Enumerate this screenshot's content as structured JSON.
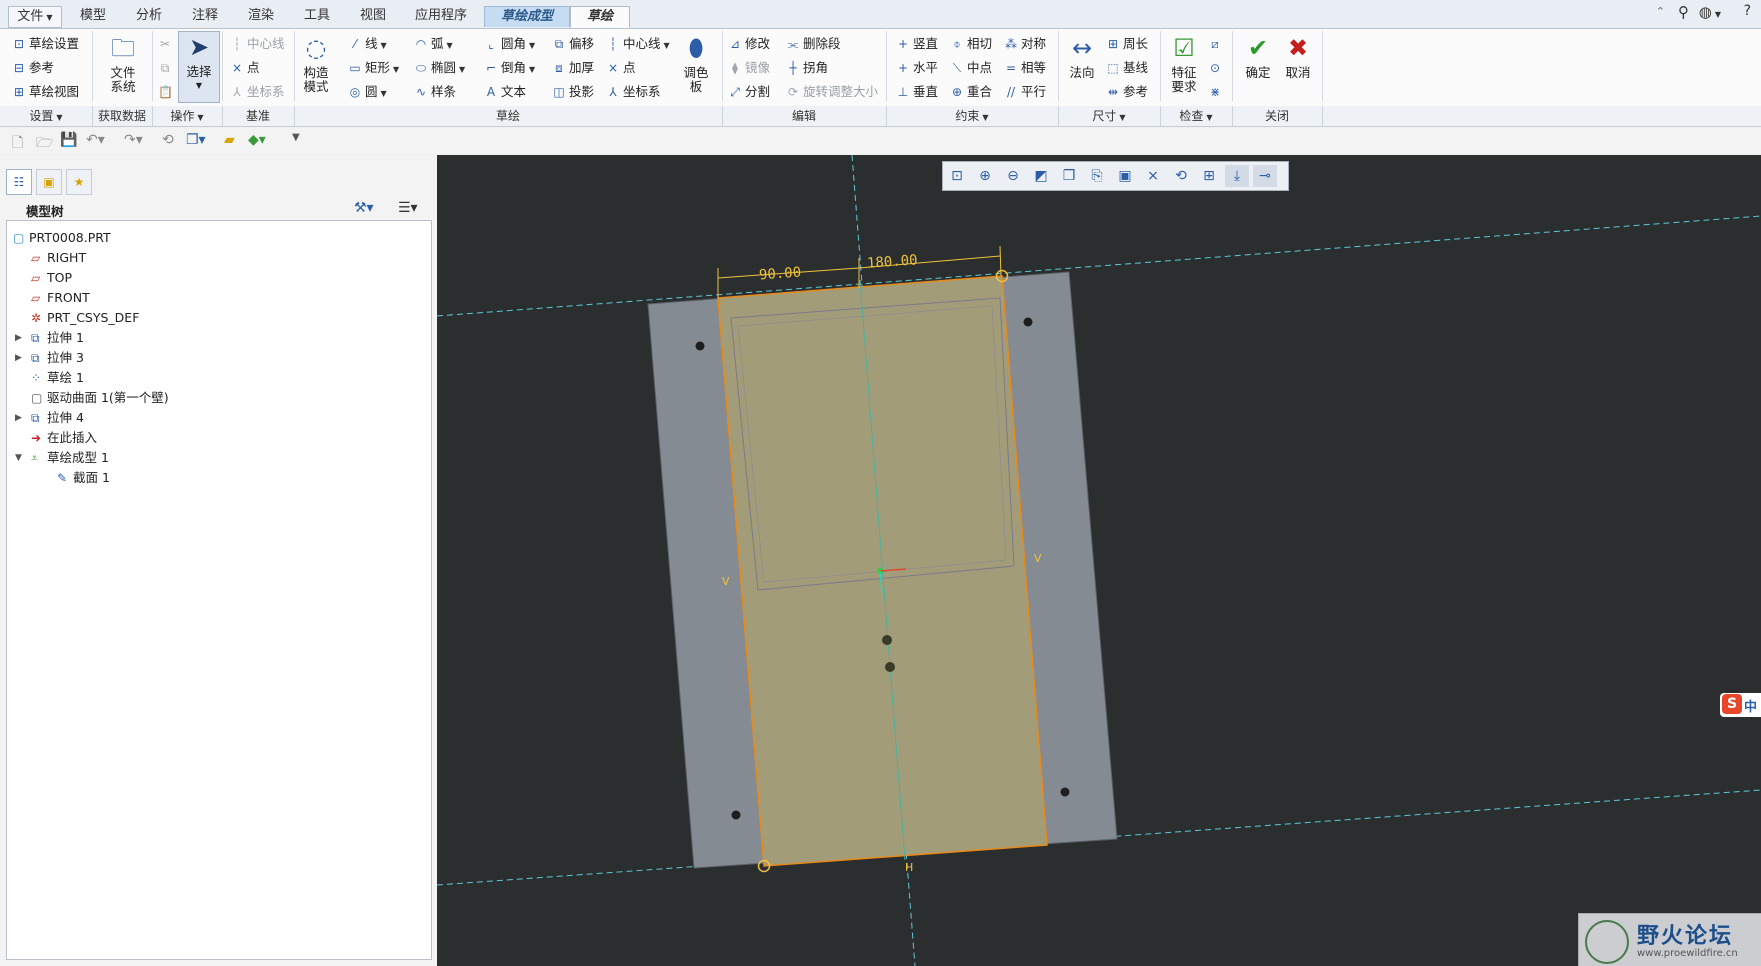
{
  "tabs": [
    {
      "label": "文件",
      "type": "file"
    },
    {
      "label": "模型"
    },
    {
      "label": "分析"
    },
    {
      "label": "注释"
    },
    {
      "label": "渲染"
    },
    {
      "label": "工具"
    },
    {
      "label": "视图"
    },
    {
      "label": "应用程序"
    },
    {
      "label": "草绘成型",
      "type": "highlight"
    },
    {
      "label": "草绘",
      "type": "active"
    }
  ],
  "ribbon": {
    "setup": {
      "items": [
        "草绘设置",
        "参考",
        "草绘视图"
      ],
      "group": "设置"
    },
    "getdata": {
      "file_system": "文件\n系统",
      "group": "获取数据"
    },
    "ops": {
      "select": "选择",
      "group": "操作"
    },
    "datum": {
      "items": [
        "中心线",
        "点",
        "坐标系"
      ],
      "group": "基准"
    },
    "sketch": {
      "construct": "构造\n模式",
      "col1": [
        "线",
        "矩形",
        "圆"
      ],
      "col2": [
        "弧",
        "椭圆",
        "样条"
      ],
      "col3": [
        "圆角",
        "倒角",
        "文本"
      ],
      "col4": [
        "偏移",
        "加厚",
        "投影"
      ],
      "col5": [
        "中心线",
        "点",
        "坐标系"
      ],
      "palette": "调色\n板",
      "group": "草绘"
    },
    "edit": {
      "col1": [
        "修改",
        "镜像",
        "分割"
      ],
      "col2": [
        "删除段",
        "拐角",
        "旋转调整大小"
      ],
      "group": "编辑"
    },
    "constrain": {
      "col1": [
        "竖直",
        "水平",
        "垂直"
      ],
      "col2": [
        "相切",
        "中点",
        "重合"
      ],
      "col3": [
        "对称",
        "相等",
        "平行"
      ],
      "group": "约束"
    },
    "dimension": {
      "normal": "法向",
      "items": [
        "周长",
        "基线",
        "参考"
      ],
      "group": "尺寸"
    },
    "inspect": {
      "feature_req": "特征\n要求",
      "group": "检查"
    },
    "close": {
      "ok": "确定",
      "cancel": "取消",
      "group": "关闭"
    }
  },
  "model_tree": {
    "title": "模型树",
    "nodes": [
      {
        "label": "PRT0008.PRT",
        "level": 0
      },
      {
        "label": "RIGHT",
        "level": 1
      },
      {
        "label": "TOP",
        "level": 1
      },
      {
        "label": "FRONT",
        "level": 1
      },
      {
        "label": "PRT_CSYS_DEF",
        "level": 1
      },
      {
        "label": "拉伸 1",
        "level": 1,
        "expand": "▶"
      },
      {
        "label": "拉伸 3",
        "level": 1,
        "expand": "▶"
      },
      {
        "label": "草绘 1",
        "level": 1
      },
      {
        "label": "驱动曲面 1(第一个壁)",
        "level": 1
      },
      {
        "label": "拉伸 4",
        "level": 1,
        "expand": "▶"
      },
      {
        "label": "在此插入",
        "level": 1
      },
      {
        "label": "草绘成型 1",
        "level": 1,
        "expand": "▼"
      },
      {
        "label": "截面 1",
        "level": 2
      }
    ]
  },
  "sketch": {
    "dim_a": "90.00",
    "dim_b": "180.00",
    "label_v": "V",
    "label_h": "H"
  },
  "watermark": {
    "title": "野火论坛",
    "url": "www.proewildfire.cn"
  },
  "ime": {
    "label": "中"
  },
  "colors": {
    "accent": "#2c5ea8",
    "sketch_fill": "#a39c78",
    "plate": "#858b93",
    "viewport": "#2b2e2f",
    "dim": "#f0c23c",
    "edge": "#e88a1a"
  }
}
